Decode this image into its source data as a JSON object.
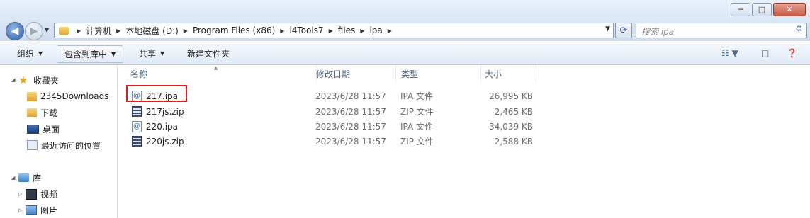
{
  "window": {
    "buttons": [
      "─",
      "□",
      "✕"
    ]
  },
  "nav_bar": {
    "breadcrumbs": [
      "计算机",
      "本地磁盘 (D:)",
      "Program Files (x86)",
      "i4Tools7",
      "files",
      "ipa"
    ],
    "search_placeholder": "搜索 ipa"
  },
  "toolbar": {
    "organize": "组织",
    "include_library": "包含到库中",
    "share": "共享",
    "new_folder": "新建文件夹"
  },
  "sidebar": {
    "favorites": {
      "label": "收藏夹",
      "items": [
        "2345Downloads",
        "下载",
        "桌面",
        "最近访问的位置"
      ]
    },
    "libraries": {
      "label": "库",
      "items": [
        "视频",
        "图片"
      ]
    }
  },
  "columns": {
    "name": "名称",
    "date": "修改日期",
    "type": "类型",
    "size": "大小"
  },
  "files": [
    {
      "name": "217.ipa",
      "date": "2023/6/28 11:57",
      "type": "IPA 文件",
      "size": "26,995 KB",
      "icon": "ipa-file-icon"
    },
    {
      "name": "217js.zip",
      "date": "2023/6/28 11:57",
      "type": "ZIP 文件",
      "size": "2,465 KB",
      "icon": "zip-file-icon"
    },
    {
      "name": "220.ipa",
      "date": "2023/6/28 11:57",
      "type": "IPA 文件",
      "size": "34,039 KB",
      "icon": "ipa-file-icon"
    },
    {
      "name": "220js.zip",
      "date": "2023/6/28 11:57",
      "type": "ZIP 文件",
      "size": "2,588 KB",
      "icon": "zip-file-icon"
    }
  ],
  "colors": {
    "highlight": "#e02020",
    "accent": "#2c5fa8"
  }
}
